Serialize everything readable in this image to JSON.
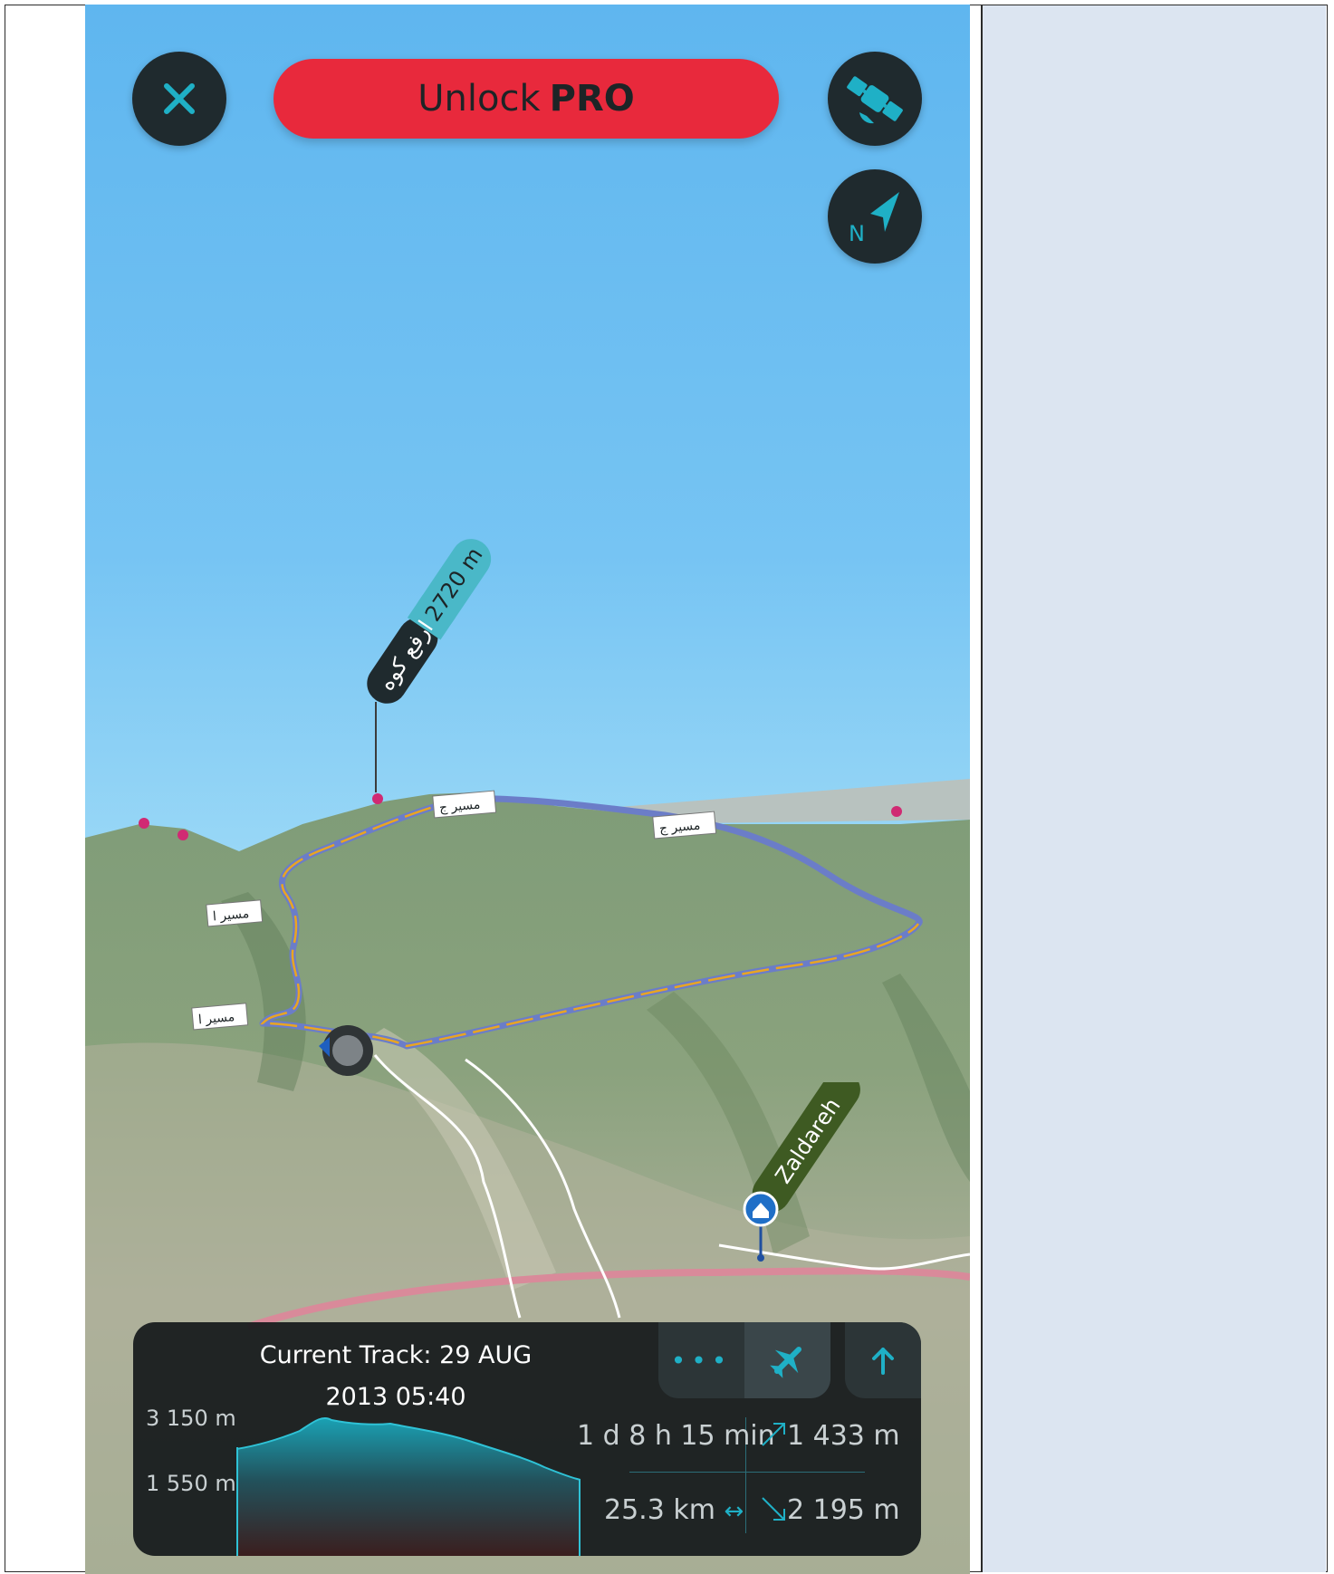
{
  "toolbar": {
    "close_icon": "close-icon",
    "unlock_prefix": "Unlock",
    "unlock_emphasis": "PRO",
    "satellite_icon": "satellite-icon",
    "compass_icon": "compass-north-icon",
    "compass_letter": "N"
  },
  "map": {
    "summit_name": "ارفع کوه",
    "summit_elevation": "2720 m",
    "village_name": "Zaldareh",
    "route_labels": [
      "مسیر ج",
      "مسیر ج",
      "مسیر ا",
      "مسیر ا"
    ]
  },
  "track_card": {
    "title_line1": "Current Track: 29 AUG",
    "title_line2": "2013 05:40",
    "elevation_max": "3 150 m",
    "elevation_min": "1 550 m",
    "duration": "1 d 8 h 15 min",
    "ascent": "1 433 m",
    "distance": "25.3 km",
    "descent": "2 195 m",
    "more_icon": "more-dots-icon",
    "flyover_icon": "airplane-icon",
    "expand_icon": "arrow-up-icon"
  },
  "colors": {
    "accent": "#1fb0c6",
    "unlock_bg": "#e8293c",
    "card_bg": "#14181a",
    "side_panel": "#dce5f1"
  }
}
